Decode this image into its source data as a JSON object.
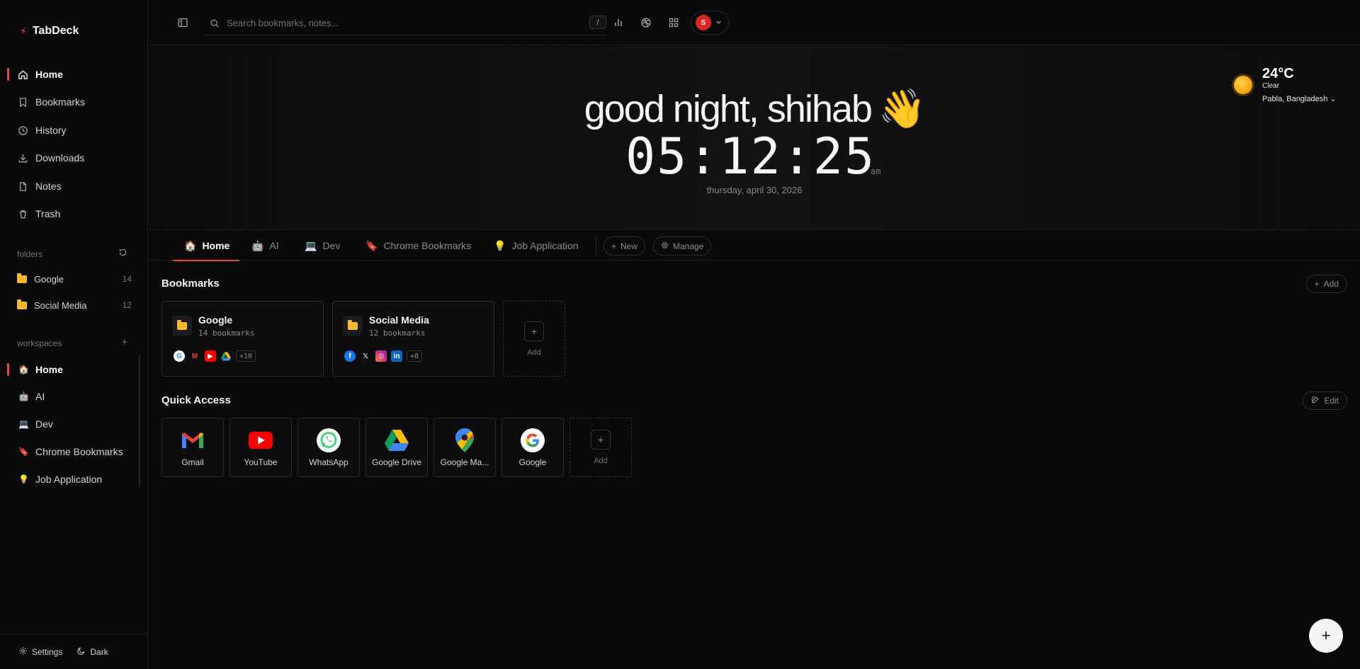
{
  "app": {
    "name": "TabDeck"
  },
  "sidebar": {
    "nav": [
      {
        "label": "Home",
        "icon": "home-icon",
        "active": true
      },
      {
        "label": "Bookmarks",
        "icon": "bookmark-icon"
      },
      {
        "label": "History",
        "icon": "history-icon"
      },
      {
        "label": "Downloads",
        "icon": "download-icon"
      },
      {
        "label": "Notes",
        "icon": "note-icon"
      },
      {
        "label": "Trash",
        "icon": "trash-icon"
      }
    ],
    "folders_title": "folders",
    "folders": [
      {
        "label": "Google",
        "count": "14"
      },
      {
        "label": "Social Media",
        "count": "12"
      }
    ],
    "workspaces_title": "workspaces",
    "workspaces": [
      {
        "label": "Home",
        "emoji": "🏠",
        "active": true
      },
      {
        "label": "AI",
        "emoji": "🤖"
      },
      {
        "label": "Dev",
        "emoji": "💻"
      },
      {
        "label": "Chrome Bookmarks",
        "emoji": "🔖"
      },
      {
        "label": "Job Application",
        "emoji": "💡"
      }
    ],
    "footer": {
      "settings": "Settings",
      "theme": "Dark"
    }
  },
  "topbar": {
    "search_placeholder": "Search bookmarks, notes...",
    "shortcut": "/",
    "avatar_initial": "S"
  },
  "hero": {
    "greeting": "good night, shihab",
    "greeting_emoji": "👋",
    "time": "05:12:25",
    "ampm": "am",
    "date": "thursday, april 30, 2026"
  },
  "weather": {
    "temp": "24°C",
    "condition": "Clear",
    "location": "Pabla, Bangladesh"
  },
  "tabs": [
    {
      "label": "Home",
      "emoji": "🏠",
      "active": true
    },
    {
      "label": "AI",
      "emoji": "🤖"
    },
    {
      "label": "Dev",
      "emoji": "💻"
    },
    {
      "label": "Chrome Bookmarks",
      "emoji": "🔖"
    },
    {
      "label": "Job Application",
      "emoji": "💡"
    }
  ],
  "tab_actions": {
    "new": "New",
    "manage": "Manage"
  },
  "bookmarks_section": {
    "title": "Bookmarks",
    "add_label": "Add",
    "cards": [
      {
        "title": "Google",
        "subtitle": "14 bookmarks",
        "more": "+10"
      },
      {
        "title": "Social Media",
        "subtitle": "12 bookmarks",
        "more": "+8"
      }
    ],
    "add_card_label": "Add"
  },
  "quick_access": {
    "title": "Quick Access",
    "edit_label": "Edit",
    "items": [
      {
        "label": "Gmail",
        "icon": "gmail-icon"
      },
      {
        "label": "YouTube",
        "icon": "youtube-icon"
      },
      {
        "label": "WhatsApp",
        "icon": "whatsapp-icon"
      },
      {
        "label": "Google Drive",
        "icon": "google-drive-icon"
      },
      {
        "label": "Google Ma...",
        "icon": "google-maps-icon"
      },
      {
        "label": "Google",
        "icon": "google-icon"
      }
    ],
    "add_label": "Add"
  },
  "colors": {
    "accent": "#ef4444",
    "background": "#0a0a0a",
    "folder": "#f5b82e"
  }
}
